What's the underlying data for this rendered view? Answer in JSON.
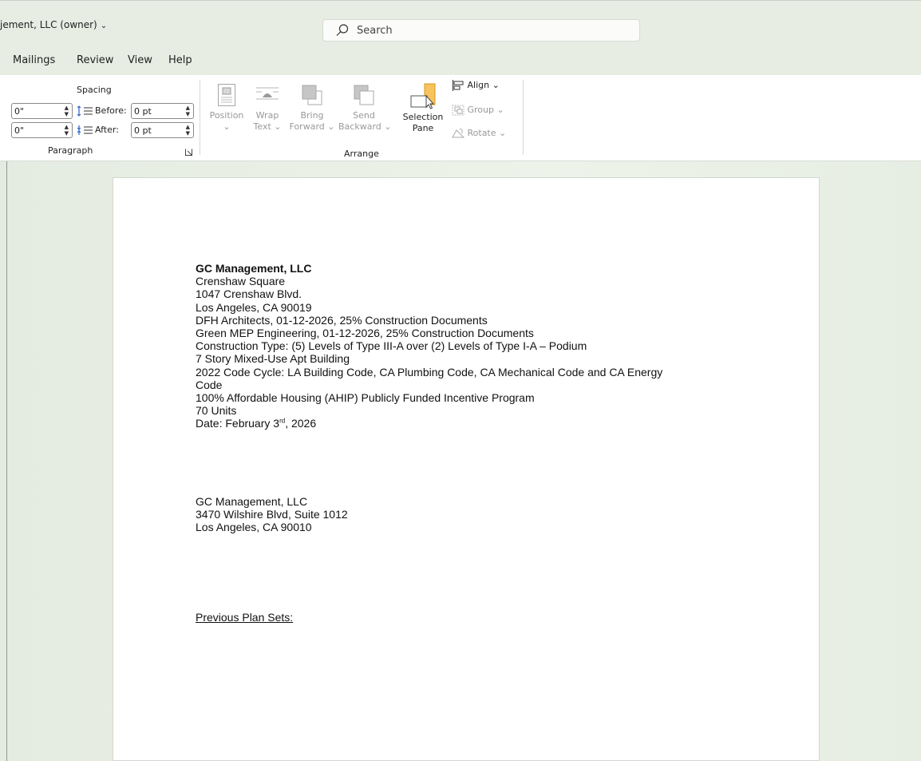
{
  "window": {
    "doc_title": "jement, LLC (owner)",
    "search_placeholder": "Search"
  },
  "menu": [
    "Mailings",
    "Review",
    "View",
    "Help"
  ],
  "ribbon": {
    "paragraph": {
      "spacing_label": "Spacing",
      "indent_left": "0\"",
      "indent_right": "0\"",
      "before_label": "Before:",
      "after_label": "After:",
      "before_value": "0 pt",
      "after_value": "0 pt",
      "group_label": "Paragraph"
    },
    "arrange": {
      "position_l1": "Position",
      "wrap_l1": "Wrap",
      "wrap_l2": "Text",
      "bring_l1": "Bring",
      "bring_l2": "Forward",
      "send_l1": "Send",
      "send_l2": "Backward",
      "selection_l1": "Selection",
      "selection_l2": "Pane",
      "align": "Align",
      "group": "Group",
      "rotate": "Rotate",
      "group_label": "Arrange"
    }
  },
  "document": {
    "header_lines": [
      "GC Management, LLC",
      "Crenshaw Square",
      "1047 Crenshaw Blvd.",
      "Los Angeles, CA 90019",
      "DFH Architects, 01-12-2026, 25% Construction Documents",
      "Green MEP Engineering, 01-12-2026, 25% Construction Documents",
      "Construction Type: (5) Levels of Type III-A over (2) Levels of Type I-A – Podium",
      "7 Story Mixed-Use Apt Building",
      "2022 Code Cycle: LA Building Code, CA Plumbing Code, CA Mechanical Code and CA Energy",
      "Code",
      "100% Affordable Housing (AHIP) Publicly Funded Incentive Program",
      "70 Units"
    ],
    "date_prefix": "Date: February 3",
    "date_sup": "rd",
    "date_suffix": ", 2026",
    "owner_lines": [
      "GC Management, LLC",
      "3470 Wilshire Blvd, Suite 1012",
      "Los Angeles, CA 90010"
    ],
    "previous_plan_sets": "Previous Plan Sets:"
  }
}
